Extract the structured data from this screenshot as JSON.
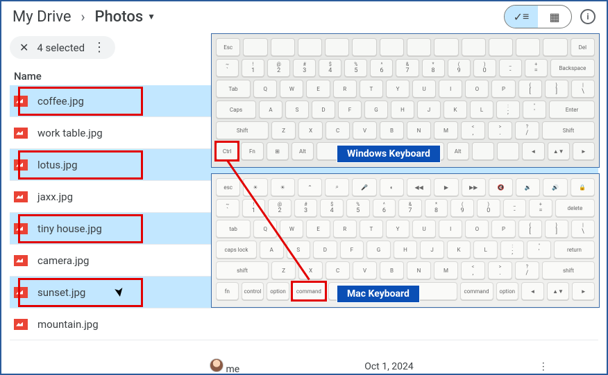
{
  "breadcrumb": {
    "root": "My Drive",
    "chevron": "›",
    "current": "Photos"
  },
  "topright": {
    "check": "✓",
    "list": "≡",
    "grid": "▦",
    "info": "i"
  },
  "selection": {
    "close": "✕",
    "text": "4 selected",
    "more": "⋮"
  },
  "columns": {
    "name": "Name"
  },
  "files": [
    {
      "name": "coffee.jpg",
      "selected": true
    },
    {
      "name": "work table.jpg",
      "selected": false
    },
    {
      "name": "lotus.jpg",
      "selected": true
    },
    {
      "name": "jaxx.jpg",
      "selected": false
    },
    {
      "name": "tiny house.jpg",
      "selected": true
    },
    {
      "name": "camera.jpg",
      "selected": false
    },
    {
      "name": "sunset.jpg",
      "selected": true,
      "cursor": true
    },
    {
      "name": "mountain.jpg",
      "selected": false
    }
  ],
  "keyboards": {
    "win": {
      "label": "Windows Keyboard",
      "highlight_key": "Ctrl",
      "rows": [
        [
          "Esc",
          "",
          "",
          "",
          "",
          "",
          "",
          "",
          "",
          "",
          "",
          "",
          "",
          "Del"
        ],
        [
          [
            "~",
            "`"
          ],
          [
            "!",
            "1"
          ],
          [
            "@",
            "2"
          ],
          [
            "#",
            "3"
          ],
          [
            "$",
            "4"
          ],
          [
            "%",
            "5"
          ],
          [
            "^",
            "6"
          ],
          [
            "&",
            "7"
          ],
          [
            "*",
            "8"
          ],
          [
            "(",
            "9"
          ],
          [
            ")",
            "0"
          ],
          [
            "_",
            "-"
          ],
          [
            "+",
            "="
          ],
          "Backspace"
        ],
        [
          "Tab",
          "Q",
          "W",
          "E",
          "R",
          "T",
          "Y",
          "U",
          "I",
          "O",
          "P",
          [
            "{",
            "["
          ],
          [
            "}",
            "]"
          ],
          [
            "|",
            "\\"
          ]
        ],
        [
          "Caps",
          "A",
          "S",
          "D",
          "F",
          "G",
          "H",
          "J",
          "K",
          "L",
          [
            ":",
            ";"
          ],
          [
            "\"",
            "'"
          ],
          "Enter"
        ],
        [
          "Shift",
          "Z",
          "X",
          "C",
          "V",
          "B",
          "N",
          "M",
          [
            "<",
            ","
          ],
          [
            ">",
            "."
          ],
          [
            "?",
            "/"
          ],
          "Shift"
        ],
        [
          "Ctrl",
          "Fn",
          "⊞",
          "Alt",
          "",
          "Alt",
          "",
          "",
          "◄",
          "▲▼",
          "►"
        ]
      ]
    },
    "mac": {
      "label": "Mac Keyboard",
      "highlight_key": "command",
      "rows": [
        [
          "esc",
          "☀",
          "☀",
          "⌃",
          "⌕",
          "🎤",
          "◐",
          "◀◀",
          "▶",
          "▶▶",
          "🔇",
          "🔉",
          "🔊",
          "🔒"
        ],
        [
          [
            "~",
            "`"
          ],
          [
            "!",
            "1"
          ],
          [
            "@",
            "2"
          ],
          [
            "#",
            "3"
          ],
          [
            "$",
            "4"
          ],
          [
            "%",
            "5"
          ],
          [
            "^",
            "6"
          ],
          [
            "&",
            "7"
          ],
          [
            "*",
            "8"
          ],
          [
            "(",
            "9"
          ],
          [
            ")",
            "0"
          ],
          [
            "_",
            "-"
          ],
          [
            "+",
            "="
          ],
          "delete"
        ],
        [
          "tab",
          "Q",
          "W",
          "E",
          "R",
          "T",
          "Y",
          "U",
          "I",
          "O",
          "P",
          [
            "{",
            "["
          ],
          [
            "}",
            "]"
          ],
          [
            "|",
            "\\"
          ]
        ],
        [
          "caps lock",
          "A",
          "S",
          "D",
          "F",
          "G",
          "H",
          "J",
          "K",
          "L",
          [
            ":",
            ";"
          ],
          [
            "\"",
            "'"
          ],
          "return"
        ],
        [
          "shift",
          "Z",
          "X",
          "C",
          "V",
          "B",
          "N",
          "M",
          [
            "<",
            ","
          ],
          [
            ">",
            "."
          ],
          [
            "?",
            "/"
          ],
          "shift"
        ],
        [
          "fn",
          "control",
          "option",
          "command",
          "",
          "command",
          "option",
          "◄",
          "▲▼",
          "►"
        ]
      ]
    }
  },
  "footer": {
    "owner": "me",
    "date": "Oct 1, 2024",
    "more": "⋮"
  },
  "highlight_color": "#e20000",
  "label_color": "#0b4fb5"
}
